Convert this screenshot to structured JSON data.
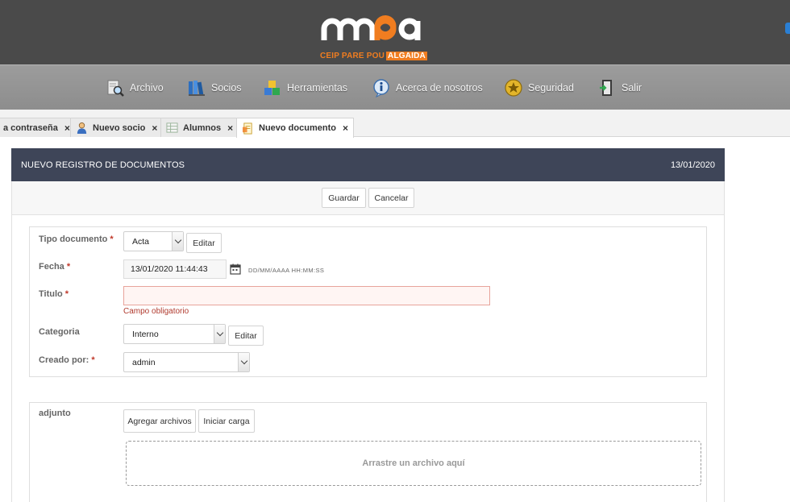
{
  "brand": {
    "logo_sub": "CEIP PARE POU",
    "logo_sub_strong": "ALGAIDA"
  },
  "colors": {
    "orange": "#f07d20",
    "dark_header": "#3e4558",
    "topbar": "#4a4a4a",
    "menubar": "#959595"
  },
  "menu": [
    {
      "label": "Archivo",
      "icon": "search-file-icon"
    },
    {
      "label": "Socios",
      "icon": "books-icon"
    },
    {
      "label": "Herramientas",
      "icon": "blocks-icon"
    },
    {
      "label": "Acerca de nosotros",
      "icon": "info-icon"
    },
    {
      "label": "Seguridad",
      "icon": "badge-icon"
    },
    {
      "label": "Salir",
      "icon": "exit-door-icon"
    }
  ],
  "tabs": [
    {
      "label": "a contraseña",
      "close": "×",
      "icon": ""
    },
    {
      "label": "Nuevo socio",
      "close": "×",
      "icon": "user-icon"
    },
    {
      "label": "Alumnos",
      "close": "×",
      "icon": "table-icon"
    },
    {
      "label": "Nuevo documento",
      "close": "×",
      "icon": "document-icon",
      "active": true
    }
  ],
  "panel": {
    "title": "NUEVO REGISTRO DE DOCUMENTOS",
    "date": "13/01/2020"
  },
  "actions": {
    "save": "Guardar",
    "cancel": "Cancelar"
  },
  "form": {
    "tipo_label": "Tipo documento",
    "tipo_value": "Acta",
    "tipo_edit": "Editar",
    "fecha_label": "Fecha",
    "fecha_value": "13/01/2020 11:44:43",
    "fecha_format": "DD/MM/AAAA HH:MM:SS",
    "titulo_label": "Titulo",
    "titulo_value": "",
    "titulo_error": "Campo obligatorio",
    "categoria_label": "Categoria",
    "categoria_value": "Interno",
    "categoria_edit": "Editar",
    "creado_label": "Creado por:",
    "creado_value": "admin",
    "required_mark": "*"
  },
  "attachments": {
    "label": "adjunto",
    "add_button": "Agregar archivos",
    "start_button": "Iniciar carga",
    "dropzone_text": "Arrastre un archivo aquí"
  }
}
